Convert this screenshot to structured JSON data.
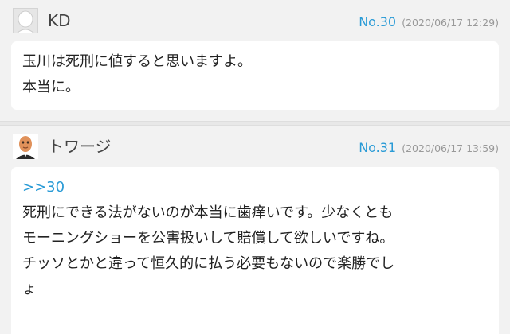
{
  "posts": [
    {
      "avatar_icon": "blank-face-avatar-icon",
      "username": "KD",
      "number": "No.30",
      "timestamp": "(2020/06/17 12:29)",
      "reply_to": "",
      "lines": [
        "玉川は死刑に値すると思いますよ。",
        "本当に。"
      ]
    },
    {
      "avatar_icon": "bald-man-avatar-icon",
      "username": "トワージ",
      "number": "No.31",
      "timestamp": "(2020/06/17 13:59)",
      "reply_to": ">>30",
      "lines": [
        "死刑にできる法がないのが本当に歯痒いです。少なくとも",
        "モーニングショーを公害扱いして賠償して欲しいですね。",
        "チッソとかと違って恒久的に払う必要もないので楽勝でし",
        "ょ"
      ]
    }
  ],
  "colors": {
    "background": "#f2f2f2",
    "card": "#ffffff",
    "link": "#2a9bd6",
    "timestamp": "#999999"
  }
}
